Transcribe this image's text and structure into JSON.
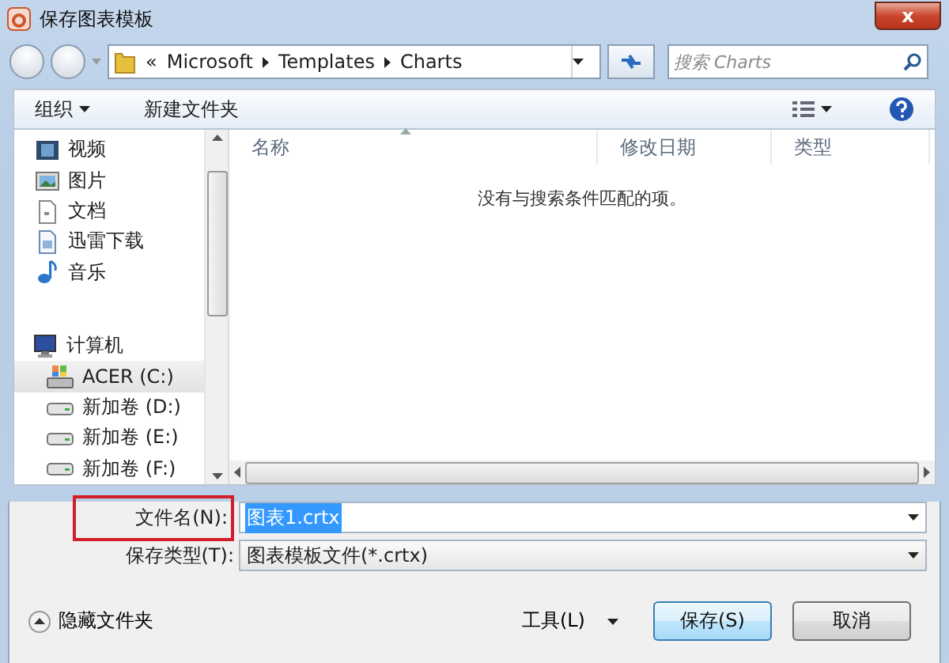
{
  "window": {
    "title": "保存图表模板",
    "close": "x"
  },
  "address": {
    "overflow": "«",
    "path": [
      "Microsoft",
      "Templates",
      "Charts"
    ]
  },
  "search": {
    "placeholder": "搜索 Charts"
  },
  "toolbar": {
    "organize": "组织",
    "new_folder": "新建文件夹"
  },
  "sidebar": {
    "items": [
      {
        "kind": "video",
        "label": "视频",
        "selected": false
      },
      {
        "kind": "picture",
        "label": "图片",
        "selected": false
      },
      {
        "kind": "document",
        "label": "文档",
        "selected": false
      },
      {
        "kind": "download",
        "label": "迅雷下载",
        "selected": false
      },
      {
        "kind": "music",
        "label": "音乐",
        "selected": false
      },
      {
        "kind": "computer",
        "label": "计算机",
        "selected": false
      },
      {
        "kind": "system-drive",
        "label": "ACER (C:)",
        "selected": true
      },
      {
        "kind": "drive",
        "label": "新加卷 (D:)",
        "selected": false
      },
      {
        "kind": "drive",
        "label": "新加卷 (E:)",
        "selected": false
      },
      {
        "kind": "drive",
        "label": "新加卷 (F:)",
        "selected": false
      }
    ]
  },
  "file_list": {
    "columns": [
      "名称",
      "修改日期",
      "类型"
    ],
    "empty_message": "没有与搜索条件匹配的项。"
  },
  "filename": {
    "label": "文件名(N):",
    "value": "图表1.crtx",
    "value_selected": true
  },
  "save_type": {
    "label": "保存类型(T):",
    "value": "图表模板文件(*.crtx)"
  },
  "footer": {
    "hide_folders": "隐藏文件夹",
    "tools": "工具(L)",
    "save": "保存(S)",
    "cancel": "取消"
  }
}
